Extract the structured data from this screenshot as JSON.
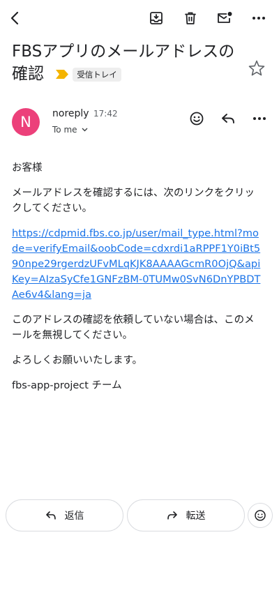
{
  "toolbar": {
    "icons": [
      "back-arrow-icon",
      "archive-icon",
      "trash-icon",
      "mark-unread-icon",
      "more-vertical-icon"
    ]
  },
  "email": {
    "subject": "FBSアプリのメールアドレスの確認",
    "label": "受信トレイ",
    "sender": {
      "initial": "N",
      "name": "noreply",
      "time": "17:42",
      "to": "To me",
      "avatar_color": "#ec407a"
    },
    "body": {
      "greeting": "お客様",
      "instruction": "メールアドレスを確認するには、次のリンクをクリックしてください。",
      "link": "https://cdpmid.fbs.co.jp/user/mail_type.html?mode=verifyEmail&oobCode=cdxrdi1aRPPF1Y0iBt590npe29rgerdzUFvMLqKJK8AAAAGcmR0OjQ&apiKey=AIzaSyCfe1GNFzBM-0TUMw0SvN6DnYPBDTAe6v4&lang=ja",
      "disclaimer": "このアドレスの確認を依頼していない場合は、このメールを無視してください。",
      "closing": "よろしくお願いいたします。",
      "signature": "fbs-app-project チーム"
    }
  },
  "actions": {
    "reply_label": "返信",
    "forward_label": "転送"
  },
  "colors": {
    "link": "#1a73e8",
    "label_arrow": "#f4b400",
    "avatar": "#ec407a"
  }
}
